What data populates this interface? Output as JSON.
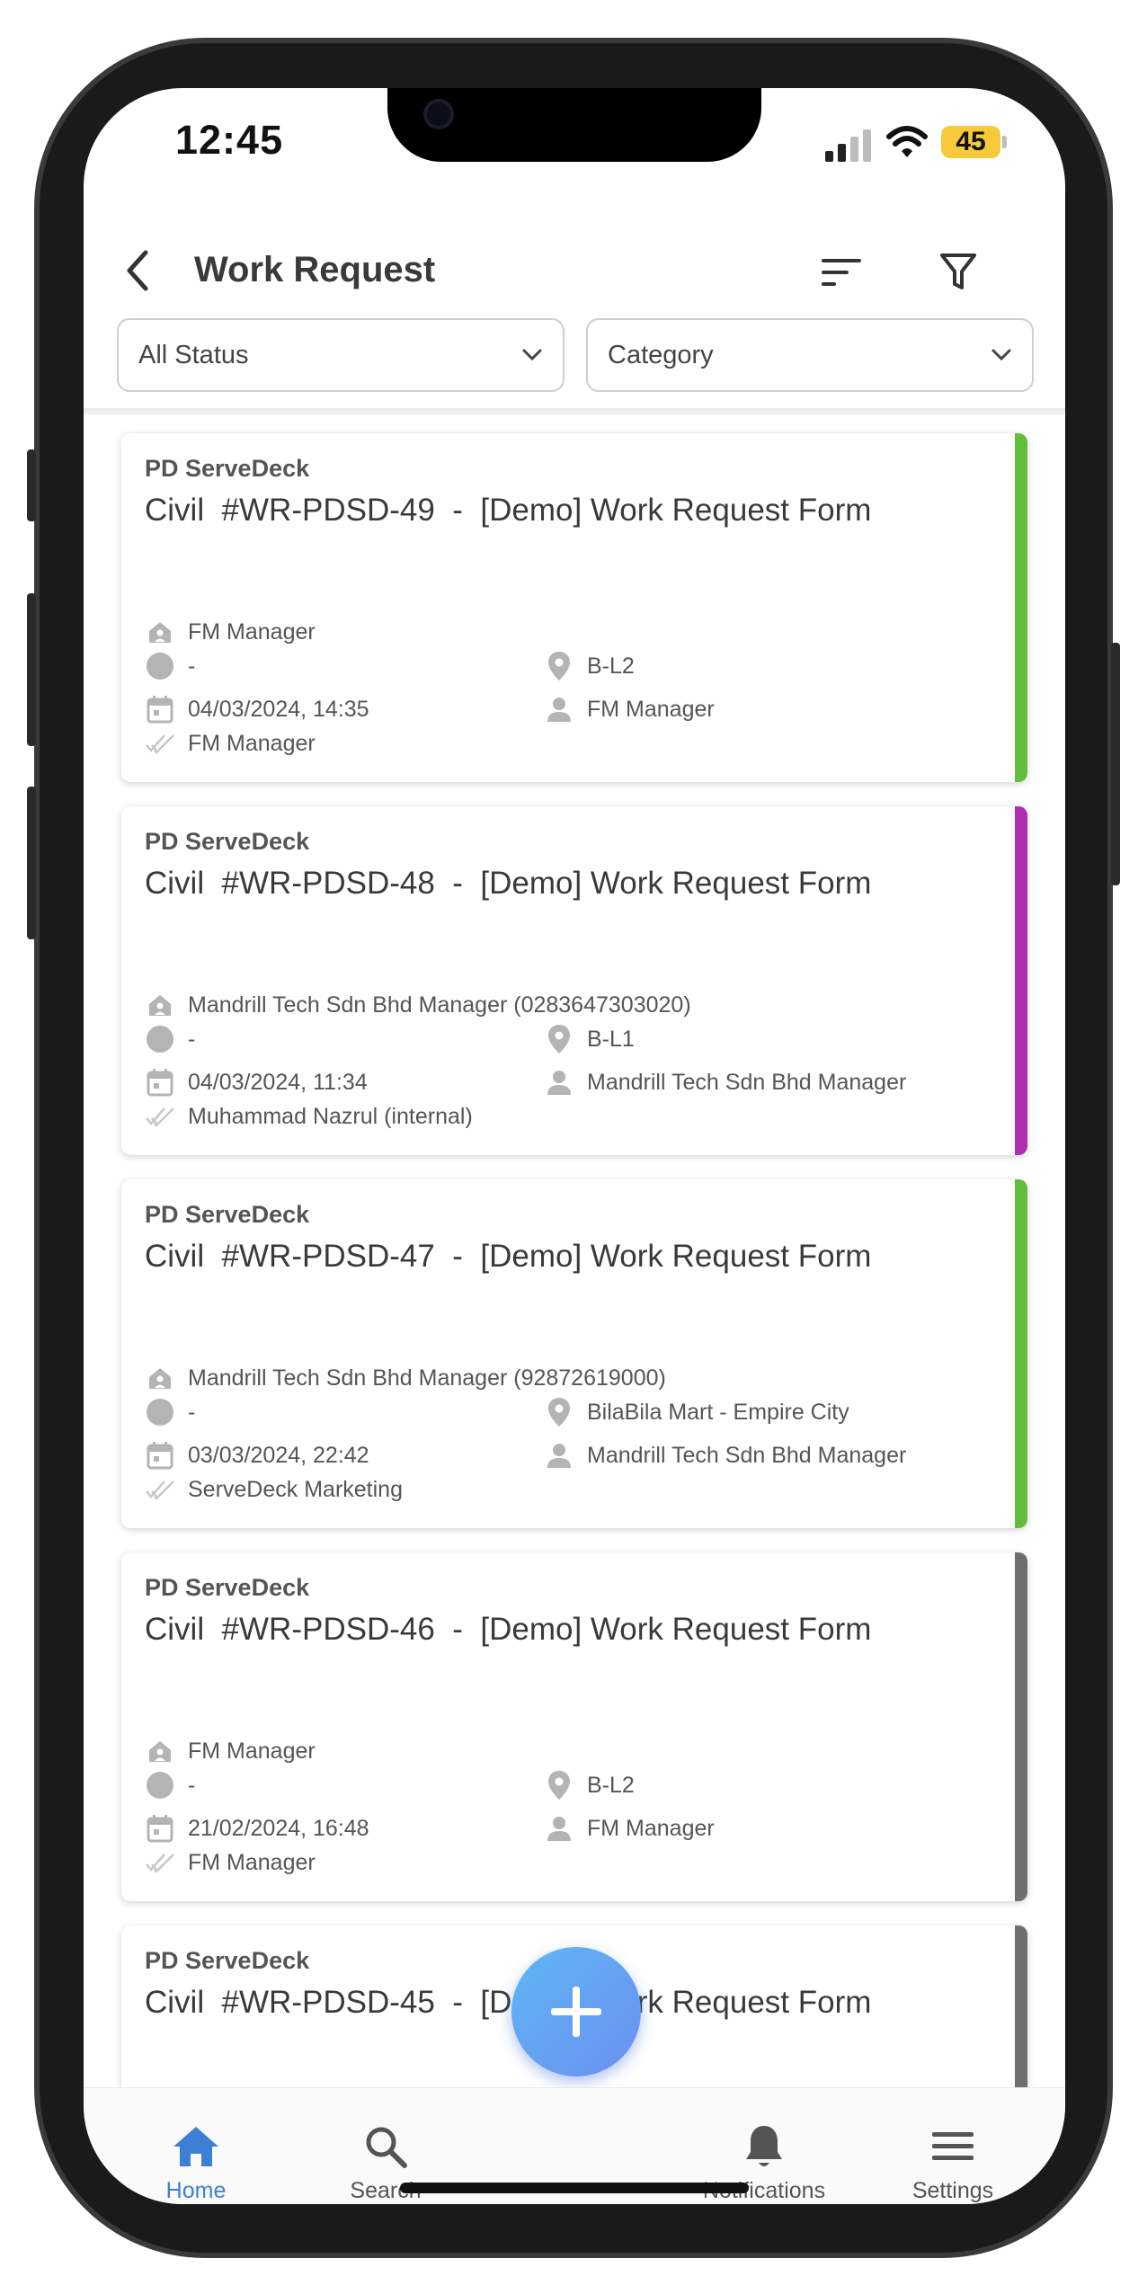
{
  "status_bar": {
    "time": "12:45",
    "battery": "45"
  },
  "header": {
    "title": "Work Request"
  },
  "filters": {
    "status": "All Status",
    "category": "Category"
  },
  "cards": [
    {
      "company": "PD ServeDeck",
      "title": "Civil  #WR-PDSD-49  -  [Demo] Work Request Form",
      "requester": "FM Manager",
      "status": "-",
      "location": "B-L2",
      "datetime": "04/03/2024, 14:35",
      "assignee": "FM Manager",
      "approver": "FM Manager",
      "color": "#63bd3a"
    },
    {
      "company": "PD ServeDeck",
      "title": "Civil  #WR-PDSD-48  -  [Demo] Work Request Form",
      "requester": "Mandrill Tech Sdn Bhd Manager (0283647303020)",
      "status": "-",
      "location": "B-L1",
      "datetime": "04/03/2024, 11:34",
      "assignee": "Mandrill Tech Sdn Bhd Manager",
      "approver": "Muhammad Nazrul (internal)",
      "color": "#b02fb0"
    },
    {
      "company": "PD ServeDeck",
      "title": "Civil  #WR-PDSD-47  -  [Demo] Work Request Form",
      "requester": "Mandrill Tech Sdn Bhd Manager (92872619000)",
      "status": "-",
      "location": "BilaBila Mart - Empire City",
      "datetime": "03/03/2024, 22:42",
      "assignee": "Mandrill Tech Sdn Bhd Manager",
      "approver": "ServeDeck Marketing",
      "color": "#63bd3a"
    },
    {
      "company": "PD ServeDeck",
      "title": "Civil  #WR-PDSD-46  -  [Demo] Work Request Form",
      "requester": "FM Manager",
      "status": "-",
      "location": "B-L2",
      "datetime": "21/02/2024, 16:48",
      "assignee": "FM Manager",
      "approver": "FM Manager",
      "color": "#6e6e6e"
    },
    {
      "company": "PD ServeDeck",
      "title": "Civil  #WR-PDSD-45  -  [Demo] Work Request Form",
      "color": "#6e6e6e"
    }
  ],
  "bottom_nav": {
    "home": "Home",
    "search": "Search",
    "notifications": "Notifications",
    "settings": "Settings"
  },
  "colors": {
    "accent": "#3d7fd4",
    "icon_gray": "#b4b4b4"
  },
  "icons": [
    "back-icon",
    "sort-icon",
    "filter-icon",
    "chevron-down-icon",
    "home-icon",
    "search-icon",
    "bell-icon",
    "menu-icon",
    "plus-icon"
  ]
}
